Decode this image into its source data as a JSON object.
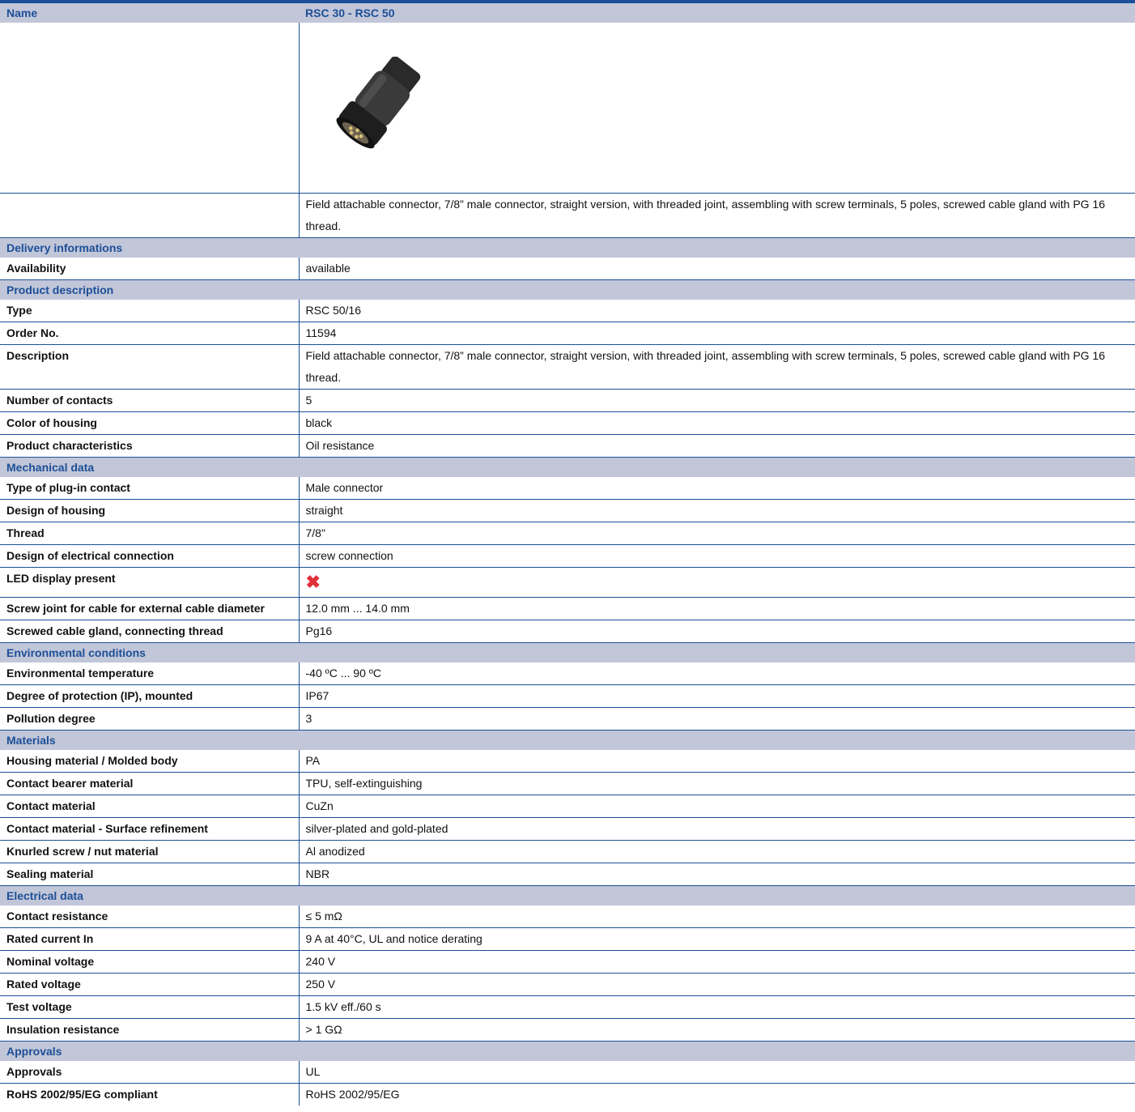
{
  "header": {
    "label": "Name",
    "value": "RSC 30 - RSC 50"
  },
  "intro_description": "Field attachable connector, 7/8” male connector, straight version, with threaded joint, assembling with screw terminals, 5 poles, screwed cable gland with PG 16 thread.",
  "sections": {
    "delivery": {
      "title": "Delivery informations",
      "rows": [
        {
          "label": "Availability",
          "value": "available"
        }
      ]
    },
    "product": {
      "title": "Product description",
      "rows": [
        {
          "label": "Type",
          "value": "RSC 50/16"
        },
        {
          "label": "Order No.",
          "value": "11594"
        },
        {
          "label": "Description",
          "value": "Field attachable connector, 7/8” male connector, straight version, with threaded joint, assembling with screw terminals, 5 poles, screwed cable gland with PG 16 thread."
        },
        {
          "label": "Number of contacts",
          "value": "5"
        },
        {
          "label": "Color of housing",
          "value": "black"
        },
        {
          "label": "Product characteristics",
          "value": "Oil resistance"
        }
      ]
    },
    "mechanical": {
      "title": "Mechanical data",
      "rows": [
        {
          "label": "Type of plug-in contact",
          "value": "Male connector"
        },
        {
          "label": "Design of housing",
          "value": "straight"
        },
        {
          "label": "Thread",
          "value": "7/8\""
        },
        {
          "label": "Design of electrical connection",
          "value": "screw connection"
        },
        {
          "label": "LED display present",
          "icon": "x-mark-icon"
        },
        {
          "label": "Screw joint for cable for external cable diameter",
          "value": "12.0 mm ... 14.0 mm"
        },
        {
          "label": "Screwed cable gland, connecting thread",
          "value": "Pg16"
        }
      ]
    },
    "environmental": {
      "title": "Environmental conditions",
      "rows": [
        {
          "label": "Environmental temperature",
          "value": "-40 ºC ... 90 ºC"
        },
        {
          "label": "Degree of protection (IP), mounted",
          "value": "IP67"
        },
        {
          "label": "Pollution degree",
          "value": "3"
        }
      ]
    },
    "materials": {
      "title": "Materials",
      "rows": [
        {
          "label": "Housing material / Molded body",
          "value": "PA"
        },
        {
          "label": "Contact bearer material",
          "value": "TPU, self-extinguishing"
        },
        {
          "label": "Contact material",
          "value": "CuZn"
        },
        {
          "label": "Contact material - Surface refinement",
          "value": "silver-plated and gold-plated"
        },
        {
          "label": "Knurled screw / nut material",
          "value": "Al anodized"
        },
        {
          "label": "Sealing material",
          "value": "NBR"
        }
      ]
    },
    "electrical": {
      "title": "Electrical data",
      "rows": [
        {
          "label": "Contact resistance",
          "value": "≤ 5 mΩ"
        },
        {
          "label": "Rated current In",
          "value": "9 A at 40°C, UL and notice derating"
        },
        {
          "label": "Nominal voltage",
          "value": "240 V"
        },
        {
          "label": "Rated voltage",
          "value": "250 V"
        },
        {
          "label": "Test voltage",
          "value": "1.5 kV eff./60 s"
        },
        {
          "label": "Insulation resistance",
          "value": "> 1 GΩ"
        }
      ]
    },
    "approvals": {
      "title": "Approvals",
      "rows": [
        {
          "label": "Approvals",
          "value": "UL"
        },
        {
          "label": "RoHS 2002/95/EG compliant",
          "value": "RoHS 2002/95/EG"
        }
      ]
    }
  },
  "colors": {
    "accent": "#1c4f97",
    "section_bg": "#c2c6d9",
    "x_mark": "#e0303a"
  }
}
